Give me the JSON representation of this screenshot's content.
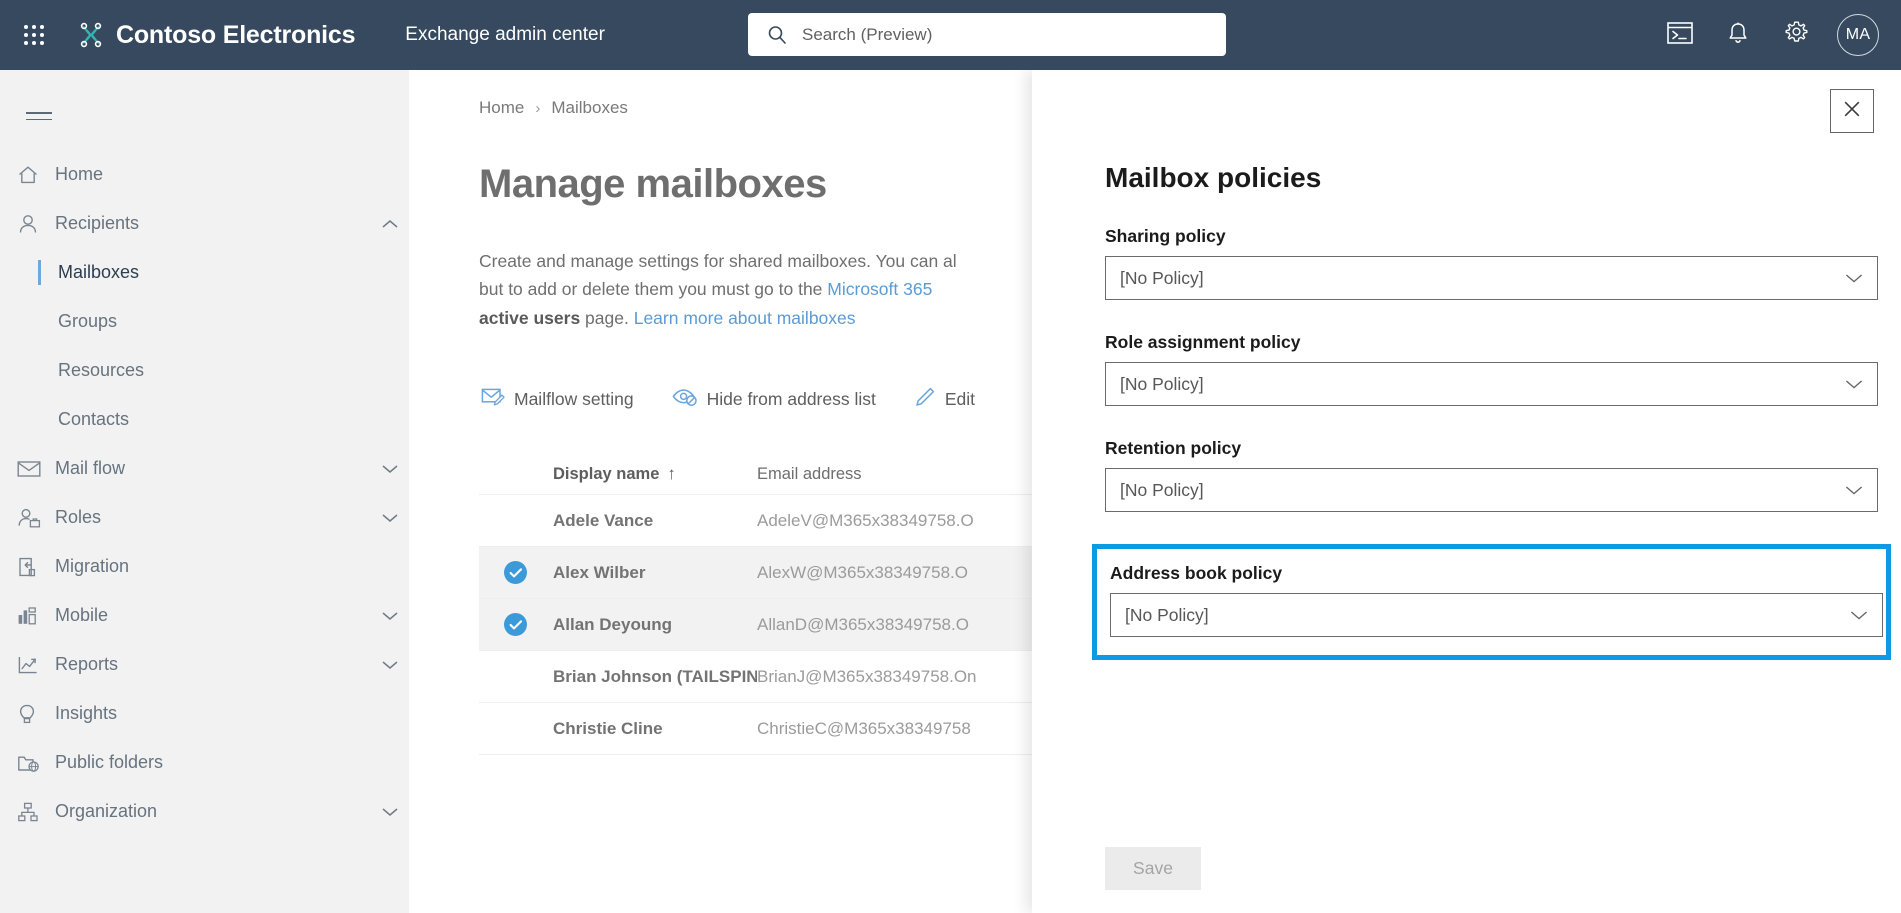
{
  "suite": {
    "waffle_label": "App launcher",
    "brand_name": "Contoso Electronics",
    "app_title": "Exchange admin center",
    "search_placeholder": "Search (Preview)",
    "search_value": "",
    "avatar_initials": "MA"
  },
  "sidebar": {
    "items": [
      {
        "label": "Home",
        "icon": "home-icon",
        "chevron": "none",
        "level": "top"
      },
      {
        "label": "Recipients",
        "icon": "person-icon",
        "chevron": "up",
        "level": "top"
      },
      {
        "label": "Mailboxes",
        "icon": "",
        "chevron": "none",
        "level": "sub",
        "active": true
      },
      {
        "label": "Groups",
        "icon": "",
        "chevron": "none",
        "level": "sub",
        "active": false
      },
      {
        "label": "Resources",
        "icon": "",
        "chevron": "none",
        "level": "sub",
        "active": false
      },
      {
        "label": "Contacts",
        "icon": "",
        "chevron": "none",
        "level": "sub",
        "active": false
      },
      {
        "label": "Mail flow",
        "icon": "envelope-icon",
        "chevron": "down",
        "level": "top"
      },
      {
        "label": "Roles",
        "icon": "person-badge-icon",
        "chevron": "down",
        "level": "top"
      },
      {
        "label": "Migration",
        "icon": "migration-icon",
        "chevron": "none",
        "level": "top"
      },
      {
        "label": "Mobile",
        "icon": "mobile-chart-icon",
        "chevron": "down",
        "level": "top"
      },
      {
        "label": "Reports",
        "icon": "trend-chart-icon",
        "chevron": "down",
        "level": "top"
      },
      {
        "label": "Insights",
        "icon": "lightbulb-icon",
        "chevron": "none",
        "level": "top"
      },
      {
        "label": "Public folders",
        "icon": "public-folder-icon",
        "chevron": "none",
        "level": "top"
      },
      {
        "label": "Organization",
        "icon": "org-hierarchy-icon",
        "chevron": "down",
        "level": "top"
      }
    ]
  },
  "main": {
    "breadcrumb": {
      "home": "Home",
      "separator": "›",
      "current": "Mailboxes"
    },
    "page_title": "Manage mailboxes",
    "description": {
      "part1": "Create and manage settings for shared mailboxes. You can al",
      "part2": "but to add or delete them you must go to the ",
      "link1": "Microsoft 365",
      "bold1": "active users",
      "part3": " page. ",
      "link2": "Learn more about mailboxes"
    },
    "toolbar": [
      {
        "label": "Mailflow setting",
        "icon": "mailflow-icon"
      },
      {
        "label": "Hide from address list",
        "icon": "hide-eye-icon"
      },
      {
        "label": "Edit",
        "icon": "pencil-icon"
      }
    ],
    "table": {
      "columns": [
        "Display name",
        "Email address"
      ],
      "sort_indicator": "↑",
      "rows": [
        {
          "selected": false,
          "display_name": "Adele Vance",
          "email": "AdeleV@M365x38349758.O"
        },
        {
          "selected": true,
          "display_name": "Alex Wilber",
          "email": "AlexW@M365x38349758.O"
        },
        {
          "selected": true,
          "display_name": "Allan Deyoung",
          "email": "AllanD@M365x38349758.O"
        },
        {
          "selected": false,
          "display_name": "Brian Johnson (TAILSPIN)",
          "email": "BrianJ@M365x38349758.On"
        },
        {
          "selected": false,
          "display_name": "Christie Cline",
          "email": "ChristieC@M365x38349758"
        }
      ]
    }
  },
  "panel": {
    "title": "Mailbox policies",
    "close_label": "Close",
    "fields": [
      {
        "label": "Sharing policy",
        "value": "[No Policy]",
        "highlighted": false
      },
      {
        "label": "Role assignment policy",
        "value": "[No Policy]",
        "highlighted": false
      },
      {
        "label": "Retention policy",
        "value": "[No Policy]",
        "highlighted": false
      },
      {
        "label": "Address book policy",
        "value": "[No Policy]",
        "highlighted": true
      }
    ],
    "save_label": "Save"
  },
  "colors": {
    "suitebar": "#36495e",
    "sidebar": "#f2f2f2",
    "accent_link": "#5b9bd5",
    "highlight_border": "#0d9ae5",
    "selected_check": "#3c9ad9",
    "brand_logo": "#34b5b0"
  }
}
